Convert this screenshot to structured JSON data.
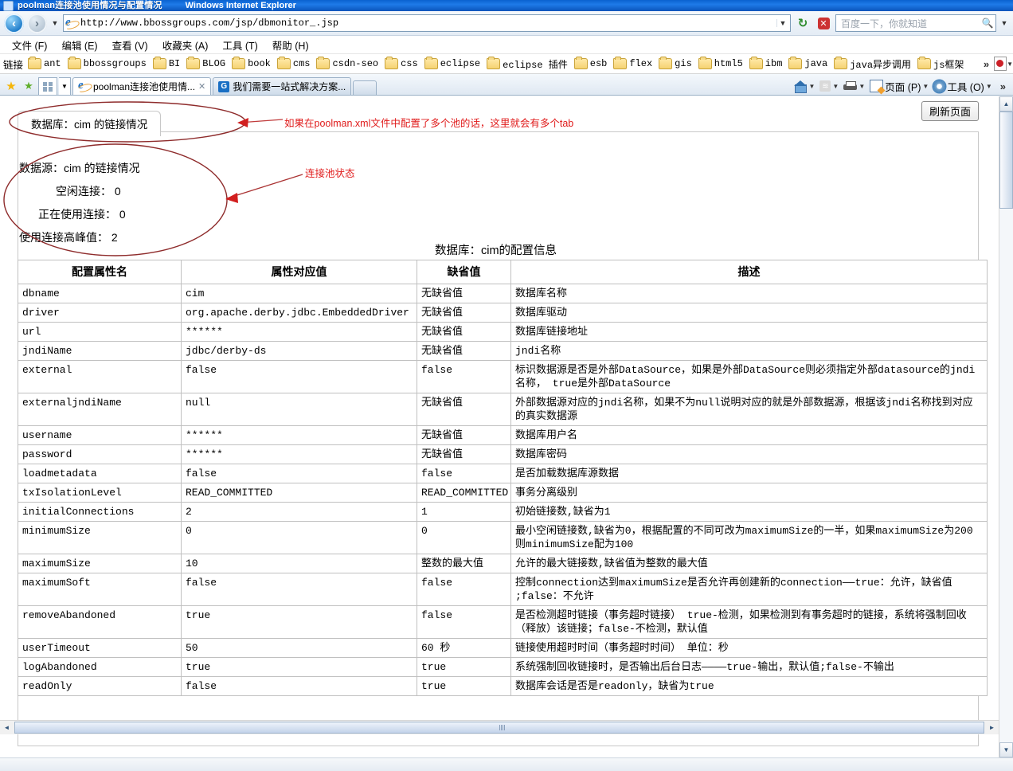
{
  "window": {
    "title": "poolman连接池使用情况与配置情况",
    "app": "Windows Internet Explorer"
  },
  "address_bar": {
    "url": "http://www.bbossgroups.com/jsp/dbmonitor_.jsp",
    "back_label": "‹",
    "forward_label": "›",
    "dropdown_label": "▼",
    "refresh_label": "↻",
    "stop_label": "✕",
    "search_placeholder": "百度一下，你就知道",
    "search_icon": "🔍"
  },
  "menu": {
    "items": [
      "文件 (F)",
      "编辑 (E)",
      "查看 (V)",
      "收藏夹 (A)",
      "工具 (T)",
      "帮助 (H)"
    ]
  },
  "links_bar": {
    "label": "链接",
    "items": [
      "ant",
      "bbossgroups",
      "BI",
      "BLOG",
      "book",
      "cms",
      "csdn-seo",
      "css",
      "eclipse",
      "eclipse 插件",
      "esb",
      "flex",
      "gis",
      "html5",
      "ibm",
      "java",
      "java异步调用",
      "js框架"
    ],
    "overflow": "»"
  },
  "tabs": {
    "quick_tabs_label": "",
    "items": [
      {
        "label": "poolman连接池使用情...",
        "close": "✕",
        "active": true
      },
      {
        "label": "我们需要一站式解决方案...",
        "icon": "G",
        "active": false
      }
    ]
  },
  "toolbar_right": {
    "items": [
      {
        "name": "home",
        "label": "",
        "caret": "▼"
      },
      {
        "name": "feeds",
        "label": "",
        "caret": "▼"
      },
      {
        "name": "print",
        "label": "",
        "caret": "▼"
      },
      {
        "name": "page",
        "label": "页面 (P)",
        "caret": "▼"
      },
      {
        "name": "tools",
        "label": "工具 (O)",
        "caret": "▼"
      }
    ],
    "overflow": "»"
  },
  "page": {
    "refresh_button": "刷新页面",
    "panel_tab": "数据库：cim 的链接情况",
    "pool_stats": [
      "数据源：cim 的链接情况",
      "空闲连接： 0",
      "正在使用连接： 0",
      "使用连接高峰值： 2"
    ],
    "config_title": "数据库：cim的配置信息",
    "annotations": [
      "如果在poolman.xml文件中配置了多个池的话，这里就会有多个tab",
      "连接池状态"
    ],
    "table": {
      "headers": [
        "配置属性名",
        "属性对应值",
        "缺省值",
        "描述"
      ],
      "rows": [
        [
          "dbname",
          "cim",
          "无缺省值",
          "数据库名称"
        ],
        [
          "driver",
          "org.apache.derby.jdbc.EmbeddedDriver",
          "无缺省值",
          "数据库驱动"
        ],
        [
          "url",
          "******",
          "无缺省值",
          "数据库链接地址"
        ],
        [
          "jndiName",
          "jdbc/derby-ds",
          "无缺省值",
          "jndi名称"
        ],
        [
          "external",
          "false",
          "false",
          "标识数据源是否是外部DataSource，如果是外部DataSource则必须指定外部datasource的jndi名称， true是外部DataSource"
        ],
        [
          "externaljndiName",
          "null",
          "无缺省值",
          "外部数据源对应的jndi名称，如果不为null说明对应的就是外部数据源，根据该jndi名称找到对应的真实数据源"
        ],
        [
          "username",
          "******",
          "无缺省值",
          "数据库用户名"
        ],
        [
          "password",
          "******",
          "无缺省值",
          "数据库密码"
        ],
        [
          "loadmetadata",
          "false",
          "false",
          "是否加载数据库源数据"
        ],
        [
          "txIsolationLevel",
          "READ_COMMITTED",
          "READ_COMMITTED",
          "事务分离级别"
        ],
        [
          "initialConnections",
          "2",
          "1",
          "初始链接数,缺省为1"
        ],
        [
          "minimumSize",
          "0",
          "0",
          "最小空闲链接数,缺省为0，根据配置的不同可改为maximumSize的一半，如果maximumSize为200则minimumSize配为100"
        ],
        [
          "maximumSize",
          "10",
          "整数的最大值",
          "允许的最大链接数,缺省值为整数的最大值"
        ],
        [
          "maximumSoft",
          "false",
          "false",
          "控制connection达到maximumSize是否允许再创建新的connection——true：允许，缺省值 ;false：不允许"
        ],
        [
          "removeAbandoned",
          "true",
          "false",
          "是否检测超时链接（事务超时链接） true-检测，如果检测到有事务超时的链接，系统将强制回收（释放）该链接；false-不检测，默认值"
        ],
        [
          "userTimeout",
          "50",
          "60 秒",
          "链接使用超时时间（事务超时时间） 单位：秒"
        ],
        [
          "logAbandoned",
          "true",
          "true",
          "系统强制回收链接时，是否输出后台日志————true-输出，默认值;false-不输出"
        ],
        [
          "readOnly",
          "false",
          "true",
          "数据库会话是否是readonly，缺省为true"
        ]
      ]
    }
  },
  "scrollbars": {
    "up_arrow": "▲",
    "down_arrow": "▼",
    "left_arrow": "◄",
    "right_arrow": "►"
  },
  "colors": {
    "annotation_red": "#e01b1b",
    "annotation_outline": "#8e2b2b",
    "title_blue": "#1e7ae8"
  }
}
